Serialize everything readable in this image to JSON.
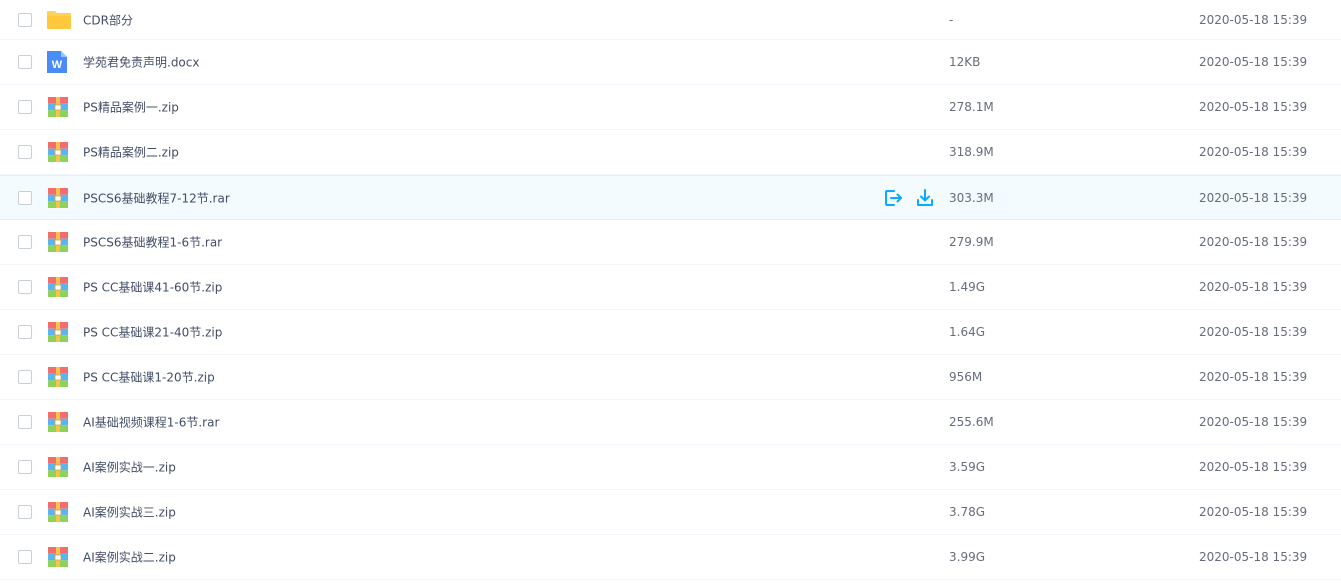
{
  "rows": [
    {
      "name": "CDR部分",
      "size": "-",
      "date": "2020-05-18 15:39",
      "icon": "folder-icon"
    },
    {
      "name": "学苑君免责声明.docx",
      "size": "12KB",
      "date": "2020-05-18 15:39",
      "icon": "word-doc-icon",
      "word_letter": "W"
    },
    {
      "name": "PS精品案例一.zip",
      "size": "278.1M",
      "date": "2020-05-18 15:39",
      "icon": "archive-icon"
    },
    {
      "name": "PS精品案例二.zip",
      "size": "318.9M",
      "date": "2020-05-18 15:39",
      "icon": "archive-icon"
    },
    {
      "name": "PSCS6基础教程7-12节.rar",
      "size": "303.3M",
      "date": "2020-05-18 15:39",
      "icon": "archive-icon",
      "hovered": true
    },
    {
      "name": "PSCS6基础教程1-6节.rar",
      "size": "279.9M",
      "date": "2020-05-18 15:39",
      "icon": "archive-icon"
    },
    {
      "name": "PS CC基础课41-60节.zip",
      "size": "1.49G",
      "date": "2020-05-18 15:39",
      "icon": "archive-icon"
    },
    {
      "name": "PS CC基础课21-40节.zip",
      "size": "1.64G",
      "date": "2020-05-18 15:39",
      "icon": "archive-icon"
    },
    {
      "name": "PS CC基础课1-20节.zip",
      "size": "956M",
      "date": "2020-05-18 15:39",
      "icon": "archive-icon"
    },
    {
      "name": "AI基础视频课程1-6节.rar",
      "size": "255.6M",
      "date": "2020-05-18 15:39",
      "icon": "archive-icon"
    },
    {
      "name": "AI案例实战一.zip",
      "size": "3.59G",
      "date": "2020-05-18 15:39",
      "icon": "archive-icon"
    },
    {
      "name": "AI案例实战三.zip",
      "size": "3.78G",
      "date": "2020-05-18 15:39",
      "icon": "archive-icon"
    },
    {
      "name": "AI案例实战二.zip",
      "size": "3.99G",
      "date": "2020-05-18 15:39",
      "icon": "archive-icon"
    }
  ],
  "hover_actions": [
    "share-icon",
    "download-icon"
  ],
  "colors": {
    "text": "#424e67",
    "secondary_text": "#666d7a",
    "accent": "#09aaff",
    "hover_background": "#f4fbff",
    "row_divider": "#f2f6fd",
    "folder": "#ffd15c",
    "word_doc": "#4a8cf7"
  }
}
